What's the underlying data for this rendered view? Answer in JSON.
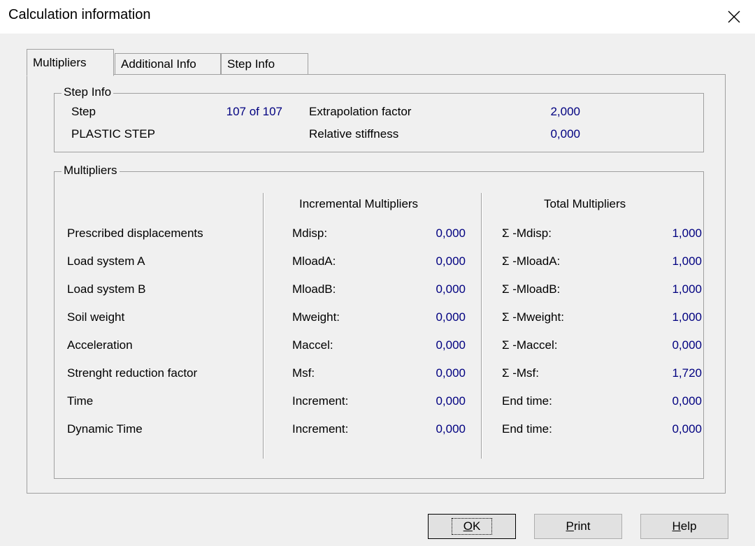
{
  "window": {
    "title": "Calculation information"
  },
  "tabs": [
    {
      "label": "Multipliers",
      "active": true
    },
    {
      "label": "Additional Info",
      "active": false
    },
    {
      "label": "Step Info",
      "active": false
    }
  ],
  "step_info": {
    "legend": "Step Info",
    "step_label": "Step",
    "step_value": "107 of 107",
    "step_type": "PLASTIC STEP",
    "extrapolation_label": "Extrapolation factor",
    "extrapolation_value": "2,000",
    "stiffness_label": "Relative stiffness",
    "stiffness_value": "0,000"
  },
  "multipliers": {
    "legend": "Multipliers",
    "incremental_header": "Incremental Multipliers",
    "total_header": "Total Multipliers",
    "rows": [
      {
        "name": "Prescribed displacements",
        "inc_label": "Mdisp:",
        "inc_value": "0,000",
        "tot_label": "Σ -Mdisp:",
        "tot_value": "1,000"
      },
      {
        "name": "Load system A",
        "inc_label": "MloadA:",
        "inc_value": "0,000",
        "tot_label": "Σ -MloadA:",
        "tot_value": "1,000"
      },
      {
        "name": "Load system B",
        "inc_label": "MloadB:",
        "inc_value": "0,000",
        "tot_label": "Σ -MloadB:",
        "tot_value": "1,000"
      },
      {
        "name": "Soil weight",
        "inc_label": "Mweight:",
        "inc_value": "0,000",
        "tot_label": "Σ -Mweight:",
        "tot_value": "1,000"
      },
      {
        "name": "Acceleration",
        "inc_label": "Maccel:",
        "inc_value": "0,000",
        "tot_label": "Σ -Maccel:",
        "tot_value": "0,000"
      },
      {
        "name": "Strenght reduction factor",
        "inc_label": "Msf:",
        "inc_value": "0,000",
        "tot_label": "Σ -Msf:",
        "tot_value": "1,720"
      },
      {
        "name": "Time",
        "inc_label": "Increment:",
        "inc_value": "0,000",
        "tot_label": "End time:",
        "tot_value": "0,000"
      },
      {
        "name": "Dynamic Time",
        "inc_label": "Increment:",
        "inc_value": "0,000",
        "tot_label": "End time:",
        "tot_value": "0,000"
      }
    ]
  },
  "buttons": {
    "ok": {
      "mnemonic": "O",
      "rest": "K"
    },
    "print": {
      "mnemonic": "P",
      "rest": "rint"
    },
    "help": {
      "mnemonic": "H",
      "rest": "elp"
    }
  }
}
